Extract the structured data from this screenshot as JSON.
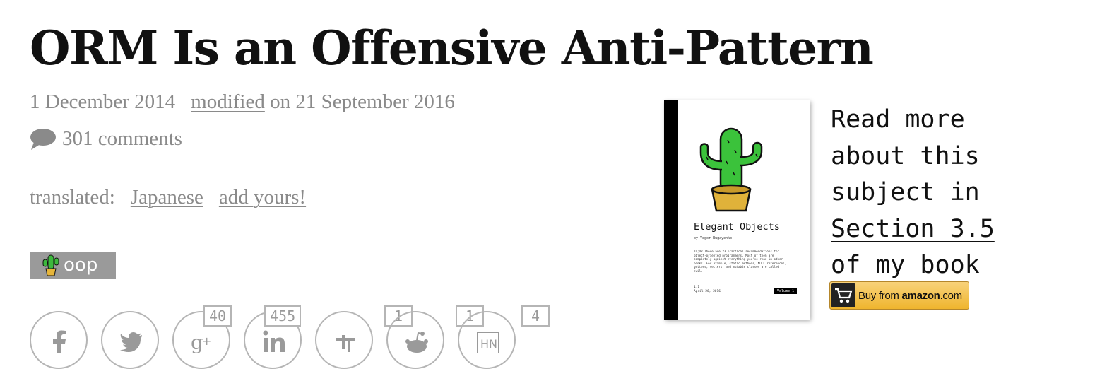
{
  "article": {
    "title": "ORM Is an Offensive Anti-Pattern",
    "date": "1 December 2014",
    "modified_label": "modified",
    "modified_date": "on 21 September 2016",
    "comments": "301 comments",
    "translated_label": "translated:",
    "translations": [
      "Japanese"
    ],
    "add_yours": "add yours!",
    "tag": "oop"
  },
  "share": {
    "buttons": [
      {
        "network": "facebook",
        "icon": "facebook-icon",
        "count": ""
      },
      {
        "network": "twitter",
        "icon": "twitter-icon",
        "count": ""
      },
      {
        "network": "google-plus",
        "icon": "google-plus-icon",
        "count": "40"
      },
      {
        "network": "linkedin",
        "icon": "linkedin-icon",
        "count": "455"
      },
      {
        "network": "delicious",
        "icon": "delicious-icon",
        "count": "1"
      },
      {
        "network": "reddit",
        "icon": "reddit-icon",
        "count": "1"
      },
      {
        "network": "hacker-news",
        "icon": "hn-icon",
        "count": "4"
      }
    ]
  },
  "book": {
    "title": "Elegant Objects",
    "author": "by Yegor Bugayenko",
    "blurb": "TL;DR There are 23 practical recommendations for object-oriented programmers. Most of them are completely against everything you've read in other books. For example, static methods, NULL references, getters, setters, and mutable classes are called evil.",
    "version": "1.1",
    "version_date": "April 26, 2016",
    "volume": "Volume 1",
    "icon": "cactus-icon"
  },
  "promo": {
    "line1": "Read more",
    "line2": "about this",
    "line3": "subject in",
    "section_link": "Section 3.5",
    "line5": "of my book"
  },
  "amazon": {
    "buy": "Buy from",
    "brand": "amazon",
    "tld": ".com"
  },
  "colors": {
    "muted": "#8a8a8a",
    "tag_bg": "#9a9a9a",
    "share_border": "#b5b5b5",
    "amazon_button": "#efb52e"
  }
}
